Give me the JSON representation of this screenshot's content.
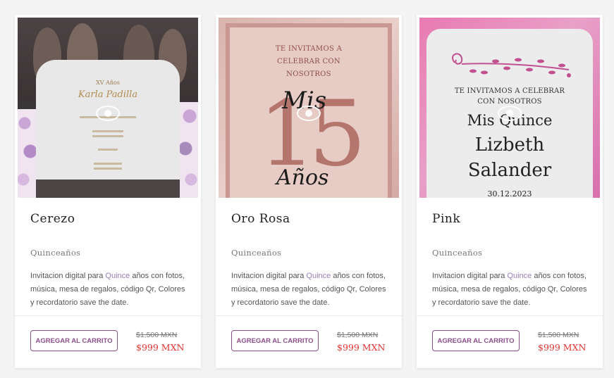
{
  "products": [
    {
      "title": "Cerezo",
      "category": "Quinceaños",
      "desc_before": "Invitacion digital para ",
      "desc_highlight": "Quince",
      "desc_after": " años con fotos, música, mesa de regalos, código Qr, Colores y recordatorio save the date.",
      "button": "AGREGAR AL CARRITO",
      "old_price": "$1,500 MXN",
      "new_price": "$999 MXN",
      "preview": {
        "heading": "XV Años",
        "name": "Karla Padilla"
      }
    },
    {
      "title": "Oro Rosa",
      "category": "Quinceaños",
      "desc_before": "Invitacion digital para ",
      "desc_highlight": "Quince",
      "desc_after": " años con fotos, música, mesa de regalos, código Qr, Colores y recordatorio save the date.",
      "button": "AGREGAR AL CARRITO",
      "old_price": "$1,500 MXN",
      "new_price": "$999 MXN",
      "preview": {
        "invite": "TE INVITAMOS A CELEBRAR CON NOSOTROS",
        "mis": "Mis",
        "number": "15",
        "anos": "Años"
      }
    },
    {
      "title": "Pink",
      "category": "Quinceaños",
      "desc_before": "Invitacion digital para ",
      "desc_highlight": "Quince",
      "desc_after": " años con fotos, música, mesa de regalos, código Qr, Colores y recordatorio save the date.",
      "button": "AGREGAR AL CARRITO",
      "old_price": "$1,500 MXN",
      "new_price": "$999 MXN",
      "preview": {
        "invite": "TE INVITAMOS A CELEBRAR CON NOSOTROS",
        "line1": "Mis Quince",
        "line2": "Lizbeth",
        "line3": "Salander",
        "date": "30.12.2023"
      }
    }
  ],
  "colors": {
    "accent": "#8e4e8c",
    "sale_price": "#e3342f",
    "highlight": "#9a7fb3"
  },
  "icons": {
    "preview": "eye-icon"
  }
}
